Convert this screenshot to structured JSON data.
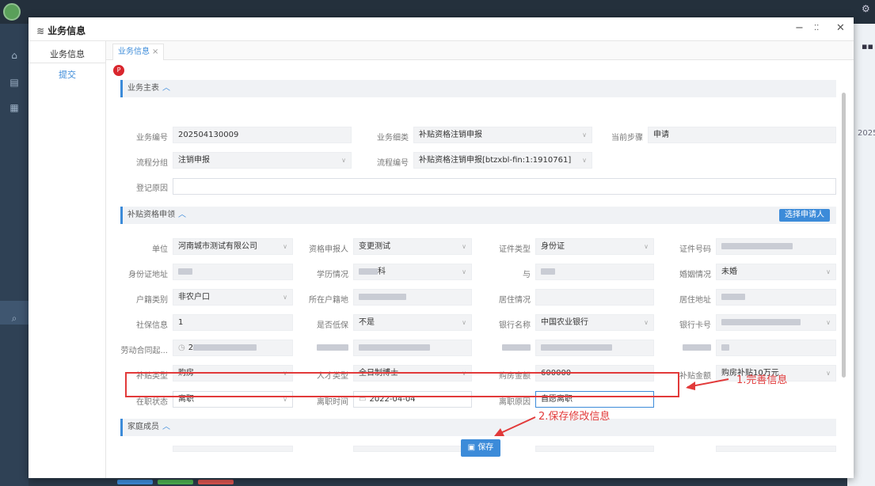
{
  "modal": {
    "title": "业务信息",
    "title_icon": "layers-icon",
    "minimize": "−",
    "maximize": "⛶",
    "close": "✕"
  },
  "side_menu": {
    "items": [
      "业务信息",
      "提交"
    ]
  },
  "tabs": [
    {
      "label": "业务信息",
      "close": "×"
    }
  ],
  "badge": "P",
  "sections": {
    "main": {
      "title": "业务主表",
      "chevron": "^"
    },
    "subsidy": {
      "title": "补贴资格申领",
      "chevron": "^",
      "button": "选择申请人"
    },
    "family": {
      "title": "家庭成员",
      "chevron": "^"
    }
  },
  "fields": {
    "biz_no": {
      "label": "业务编号",
      "value": "202504130009"
    },
    "biz_type": {
      "label": "业务细类",
      "value": "补贴资格注销申报"
    },
    "current_step": {
      "label": "当前步骤",
      "value": "申请"
    },
    "flow_group": {
      "label": "流程分组",
      "value": "注销申报"
    },
    "flow_no": {
      "label": "流程编号",
      "value": "补贴资格注销申报[btzxbl-fin:1:1910761]"
    },
    "reason": {
      "label": "登记原因",
      "value": ""
    },
    "unit": {
      "label": "单位",
      "value": "河南城市测试有限公司"
    },
    "applicant": {
      "label": "资格申报人",
      "value": "变更测试"
    },
    "id_type": {
      "label": "证件类型",
      "value": "身份证"
    },
    "id_no": {
      "label": "证件号码",
      "value": ""
    },
    "id_addr": {
      "label": "身份证地址",
      "value": ""
    },
    "education": {
      "label": "学历情况",
      "value": "科"
    },
    "unknown1": {
      "label": "与",
      "value": ""
    },
    "marital": {
      "label": "婚姻情况",
      "value": "未婚"
    },
    "hukou_type": {
      "label": "户籍类别",
      "value": "非农户口"
    },
    "hukou_loc": {
      "label": "所在户籍地",
      "value": ""
    },
    "residence": {
      "label": "居住情况",
      "value": ""
    },
    "address": {
      "label": "居住地址",
      "value": ""
    },
    "social": {
      "label": "社保信息",
      "value": "1"
    },
    "low_income": {
      "label": "是否低保",
      "value": "不是"
    },
    "bank": {
      "label": "银行名称",
      "value": "中国农业银行"
    },
    "card_no": {
      "label": "银行卡号",
      "value": ""
    },
    "contract": {
      "label": "劳动合同起...",
      "value": "2"
    },
    "subsidy_type": {
      "label": "补贴类型",
      "value": "购房"
    },
    "talent_type": {
      "label": "人才类型",
      "value": "全日制博士"
    },
    "house_amount": {
      "label": "购房金额",
      "value": "600000"
    },
    "subsidy_amount": {
      "label": "补贴金额",
      "value": "购房补贴10万元"
    },
    "job_status": {
      "label": "在职状态",
      "value": "离职"
    },
    "leave_date": {
      "label": "离职时间",
      "value": "2022-04-04"
    },
    "leave_reason": {
      "label": "离职原因",
      "value": "自愿离职"
    }
  },
  "annotations": {
    "step1": "1.完善信息",
    "step2": "2.保存修改信息"
  },
  "save_button": {
    "icon": "save-icon",
    "label": "保存"
  },
  "colors": {
    "accent": "#3c8bd9",
    "annotation": "#e23a3a"
  },
  "background": {
    "right_year": "2025"
  }
}
